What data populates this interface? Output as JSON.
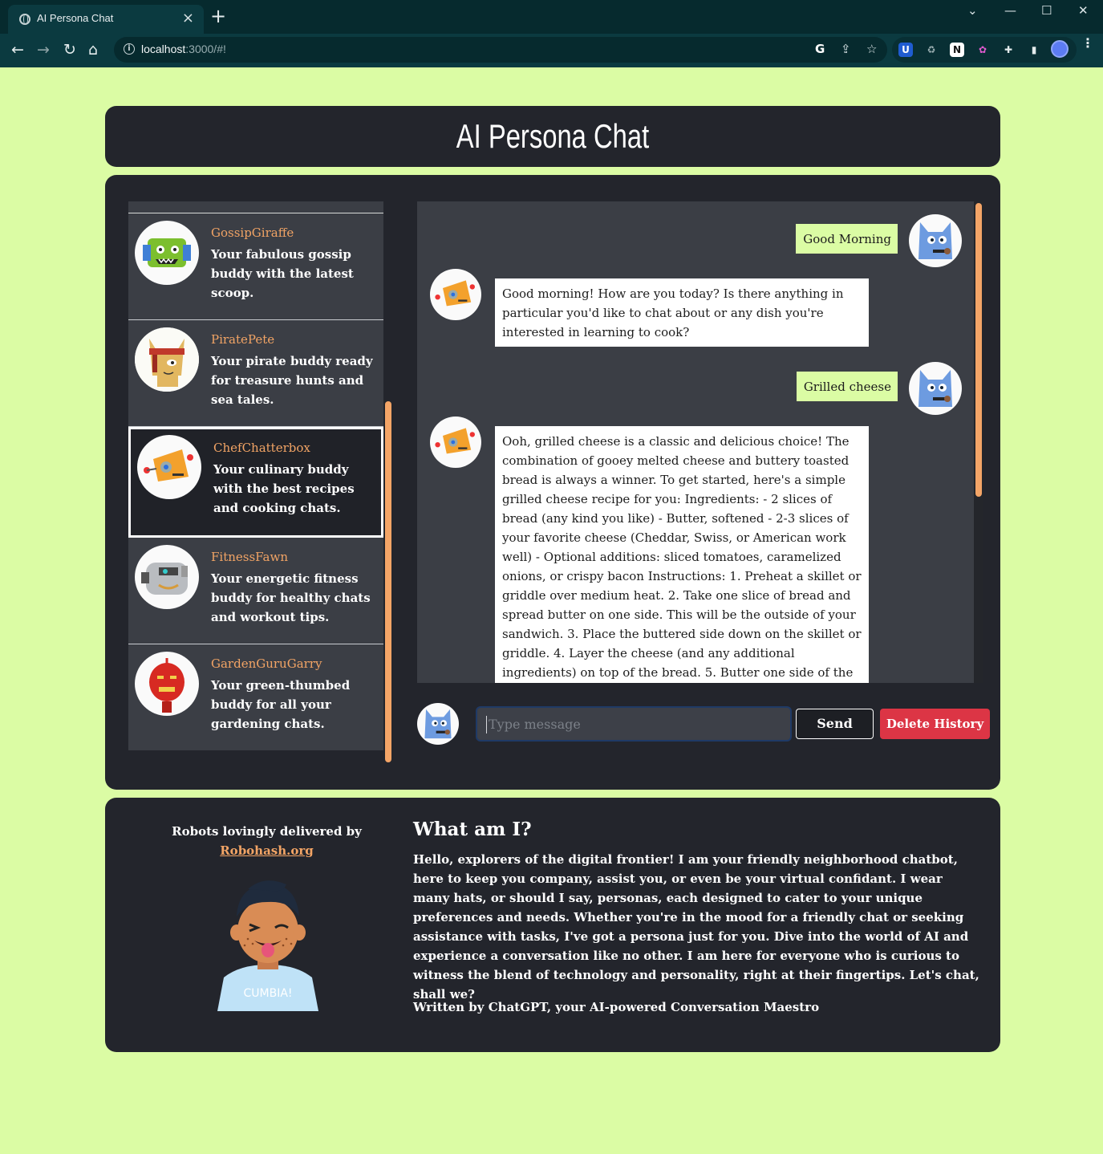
{
  "browser": {
    "tab_title": "AI Persona Chat",
    "url_host": "localhost",
    "url_path": ":3000/#!"
  },
  "app": {
    "title": "AI Persona Chat"
  },
  "personas": [
    {
      "name": "GossipGiraffe",
      "description": "Your fabulous gossip buddy with the latest scoop.",
      "icon": "green-robot-avatar"
    },
    {
      "name": "PiratePete",
      "description": "Your pirate buddy ready for treasure hunts and sea tales.",
      "icon": "pirate-cat-avatar"
    },
    {
      "name": "ChefChatterbox",
      "description": "Your culinary buddy with the best recipes and cooking chats.",
      "icon": "orange-robot-avatar"
    },
    {
      "name": "FitnessFawn",
      "description": "Your energetic fitness buddy for healthy chats and workout tips.",
      "icon": "gray-robot-avatar"
    },
    {
      "name": "GardenGuruGarry",
      "description": "Your green-thumbed buddy for all your gardening chats.",
      "icon": "red-robot-avatar"
    }
  ],
  "messages": [
    {
      "role": "user",
      "text": "Good Morning"
    },
    {
      "role": "bot",
      "text": "Good morning! How are you today? Is there anything in particular you'd like to chat about or any dish you're interested in learning to cook?"
    },
    {
      "role": "user",
      "text": "Grilled cheese"
    },
    {
      "role": "bot",
      "text": "Ooh, grilled cheese is a classic and delicious choice! The combination of gooey melted cheese and buttery toasted bread is always a winner. To get started, here's a simple grilled cheese recipe for you: Ingredients: - 2 slices of bread (any kind you like) - Butter, softened - 2-3 slices of your favorite cheese (Cheddar, Swiss, or American work well) - Optional additions: sliced tomatoes, caramelized onions, or crispy bacon Instructions: 1. Preheat a skillet or griddle over medium heat. 2. Take one slice of bread and spread butter on one side. This will be the outside of your sandwich. 3. Place the buttered side down on the skillet or griddle. 4. Layer the cheese (and any additional ingredients) on top of the bread. 5. Butter one side of the"
    }
  ],
  "input": {
    "placeholder": "Type message",
    "value": ""
  },
  "buttons": {
    "send": "Send",
    "delete": "Delete History"
  },
  "footer": {
    "credit_text": "Robots lovingly delivered by",
    "credit_link": "Robohash.org",
    "shirt_text": "CUMBIA!",
    "about_title": "What am I?",
    "about_text": "Hello, explorers of the digital frontier! I am your friendly neighborhood chatbot, here to keep you company, assist you, or even be your virtual confidant. I wear many hats, or should I say, personas, each designed to cater to your unique preferences and needs. Whether you're in the mood for a friendly chat or seeking assistance with tasks, I've got a persona just for you. Dive into the world of AI and experience a conversation like no other. I am here for everyone who is curious to witness the blend of technology and personality, right at their fingertips. Let's chat, shall we?",
    "about_sign": "Written by ChatGPT, your AI-powered Conversation Maestro"
  },
  "colors": {
    "page_bg": "#dbfca4",
    "panel": "#23252c",
    "accent": "#f2a465",
    "danger": "#dc3545"
  }
}
